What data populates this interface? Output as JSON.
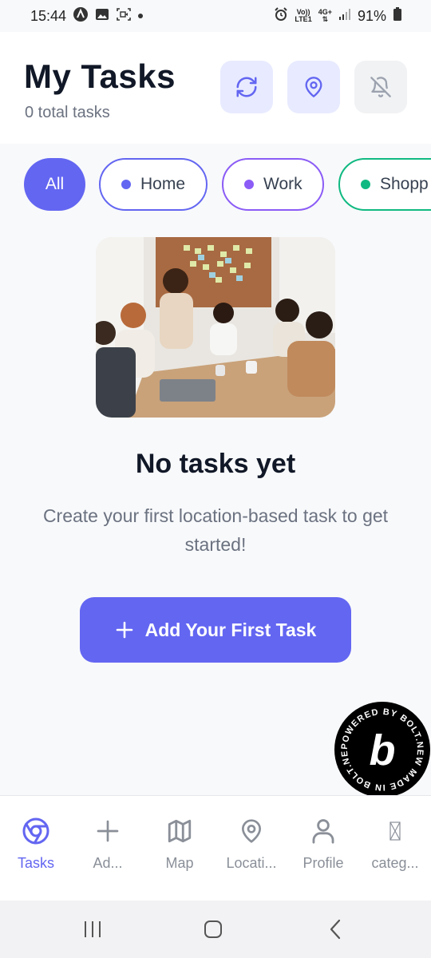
{
  "status_bar": {
    "time": "15:44",
    "volte": "Vo))",
    "lte": "LTE1",
    "network": "4G+",
    "battery": "91%"
  },
  "header": {
    "title": "My Tasks",
    "subtitle": "0 total tasks"
  },
  "filters": [
    {
      "label": "All",
      "active": true
    },
    {
      "label": "Home",
      "color": "#6366f1"
    },
    {
      "label": "Work",
      "color": "#8b5cf6"
    },
    {
      "label": "Shopp",
      "color": "#10b981"
    }
  ],
  "empty_state": {
    "title": "No tasks yet",
    "description": "Create your first location-based task to get started!",
    "button_label": "Add Your First Task"
  },
  "badge": {
    "ring_text": "POWERED BY BOLT.NEW MADE IN BOLT.NEW",
    "letter": "b"
  },
  "tabs": [
    {
      "label": "Tasks",
      "icon": "tasks-icon",
      "active": true
    },
    {
      "label": "Ad...",
      "icon": "plus-icon"
    },
    {
      "label": "Map",
      "icon": "map-icon"
    },
    {
      "label": "Locati...",
      "icon": "location-pin-icon"
    },
    {
      "label": "Profile",
      "icon": "user-icon"
    },
    {
      "label": "categ...",
      "icon": "missing-glyph-icon"
    }
  ],
  "colors": {
    "accent": "#6366f1",
    "work": "#8b5cf6",
    "shopping": "#10b981"
  }
}
